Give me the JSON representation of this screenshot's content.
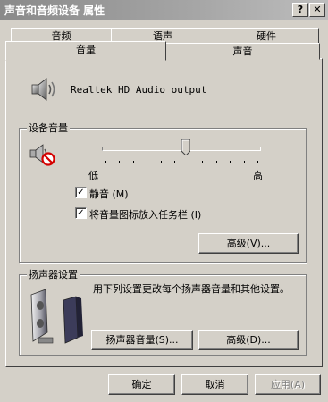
{
  "window": {
    "title": "声音和音频设备 属性",
    "help_label": "?",
    "close_label": "✕"
  },
  "tabs": {
    "row_back": [
      "音频",
      "语声",
      "硬件"
    ],
    "row_front": [
      "音量",
      "声音"
    ],
    "active": "音量"
  },
  "device": {
    "name": "Realtek HD Audio output"
  },
  "device_volume": {
    "group_label": "设备音量",
    "low_label": "低",
    "high_label": "高",
    "level": 0.5,
    "mute_label": "静音 (M)",
    "mute_checked": true,
    "tray_label": "将音量图标放入任务栏 (I)",
    "tray_checked": true,
    "advanced_label": "高级(V)..."
  },
  "speaker_settings": {
    "group_label": "扬声器设置",
    "description": "用下列设置更改每个扬声器音量和其他设置。",
    "speaker_volume_label": "扬声器音量(S)...",
    "advanced_label": "高级(D)..."
  },
  "footer": {
    "ok_label": "确定",
    "cancel_label": "取消",
    "apply_label": "应用(A)"
  },
  "colors": {
    "face": "#d4d0c8",
    "title_gradient_start": "#8a8a8a",
    "shadow": "#808080"
  }
}
